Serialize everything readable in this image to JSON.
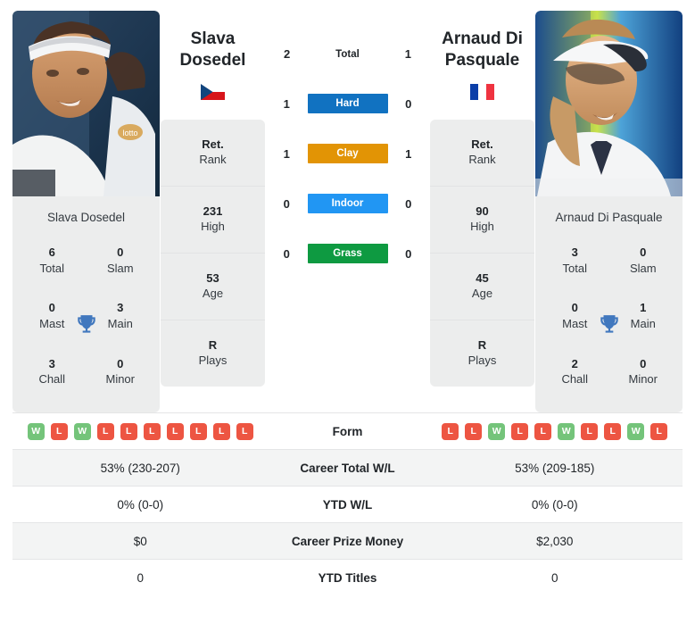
{
  "players": {
    "left": {
      "name": "Slava Dosedel",
      "name_line1": "Slava",
      "name_line2": "Dosedel",
      "country": "Czech Republic",
      "flag_icon": "flag-czech-republic-icon",
      "rank": {
        "value": "Ret.",
        "label": "Rank"
      },
      "high": {
        "value": "231",
        "label": "High"
      },
      "age": {
        "value": "53",
        "label": "Age"
      },
      "plays": {
        "value": "R",
        "label": "Plays"
      },
      "titles": [
        {
          "value": "6",
          "label": "Total"
        },
        {
          "value": "0",
          "label": "Slam"
        },
        {
          "value": "0",
          "label": "Mast"
        },
        {
          "value": "3",
          "label": "Main"
        },
        {
          "value": "3",
          "label": "Chall"
        },
        {
          "value": "0",
          "label": "Minor"
        }
      ],
      "form": [
        "W",
        "L",
        "W",
        "L",
        "L",
        "L",
        "L",
        "L",
        "L",
        "L"
      ],
      "career_total_wl": "53% (230-207)",
      "ytd_wl": "0% (0-0)",
      "career_prize_money": "$0",
      "ytd_titles": "0"
    },
    "right": {
      "name": "Arnaud Di Pasquale",
      "name_line1": "Arnaud Di",
      "name_line2": "Pasquale",
      "country": "France",
      "flag_icon": "flag-france-icon",
      "rank": {
        "value": "Ret.",
        "label": "Rank"
      },
      "high": {
        "value": "90",
        "label": "High"
      },
      "age": {
        "value": "45",
        "label": "Age"
      },
      "plays": {
        "value": "R",
        "label": "Plays"
      },
      "titles": [
        {
          "value": "3",
          "label": "Total"
        },
        {
          "value": "0",
          "label": "Slam"
        },
        {
          "value": "0",
          "label": "Mast"
        },
        {
          "value": "1",
          "label": "Main"
        },
        {
          "value": "2",
          "label": "Chall"
        },
        {
          "value": "0",
          "label": "Minor"
        }
      ],
      "form": [
        "L",
        "L",
        "W",
        "L",
        "L",
        "W",
        "L",
        "L",
        "W",
        "L"
      ],
      "career_total_wl": "53% (209-185)",
      "ytd_wl": "0% (0-0)",
      "career_prize_money": "$2,030",
      "ytd_titles": "0"
    }
  },
  "head_to_head": [
    {
      "label": "Total",
      "left": "2",
      "right": "1",
      "style": "plain",
      "color": ""
    },
    {
      "label": "Hard",
      "left": "1",
      "right": "0",
      "style": "pill",
      "color": "#1172c1"
    },
    {
      "label": "Clay",
      "left": "1",
      "right": "1",
      "style": "pill",
      "color": "#e29405"
    },
    {
      "label": "Indoor",
      "left": "0",
      "right": "0",
      "style": "pill",
      "color": "#2196f3"
    },
    {
      "label": "Grass",
      "left": "0",
      "right": "0",
      "style": "pill",
      "color": "#0e9a41"
    }
  ],
  "stat_rows": [
    {
      "label": "Form",
      "type": "form",
      "left": "",
      "right": "",
      "alt": false
    },
    {
      "label": "Career Total W/L",
      "type": "text",
      "left": "53% (230-207)",
      "right": "53% (209-185)",
      "alt": true
    },
    {
      "label": "YTD W/L",
      "type": "text",
      "left": "0% (0-0)",
      "right": "0% (0-0)",
      "alt": false
    },
    {
      "label": "Career Prize Money",
      "type": "text",
      "left": "$0",
      "right": "$2,030",
      "alt": true
    },
    {
      "label": "YTD Titles",
      "type": "text",
      "left": "0",
      "right": "0",
      "alt": false
    }
  ],
  "colors": {
    "card_bg": "#eceded",
    "row_alt_bg": "#f3f4f4",
    "win_badge": "#74c47a",
    "loss_badge": "#ed5542",
    "trophy": "#4178be",
    "text": "#212529"
  }
}
